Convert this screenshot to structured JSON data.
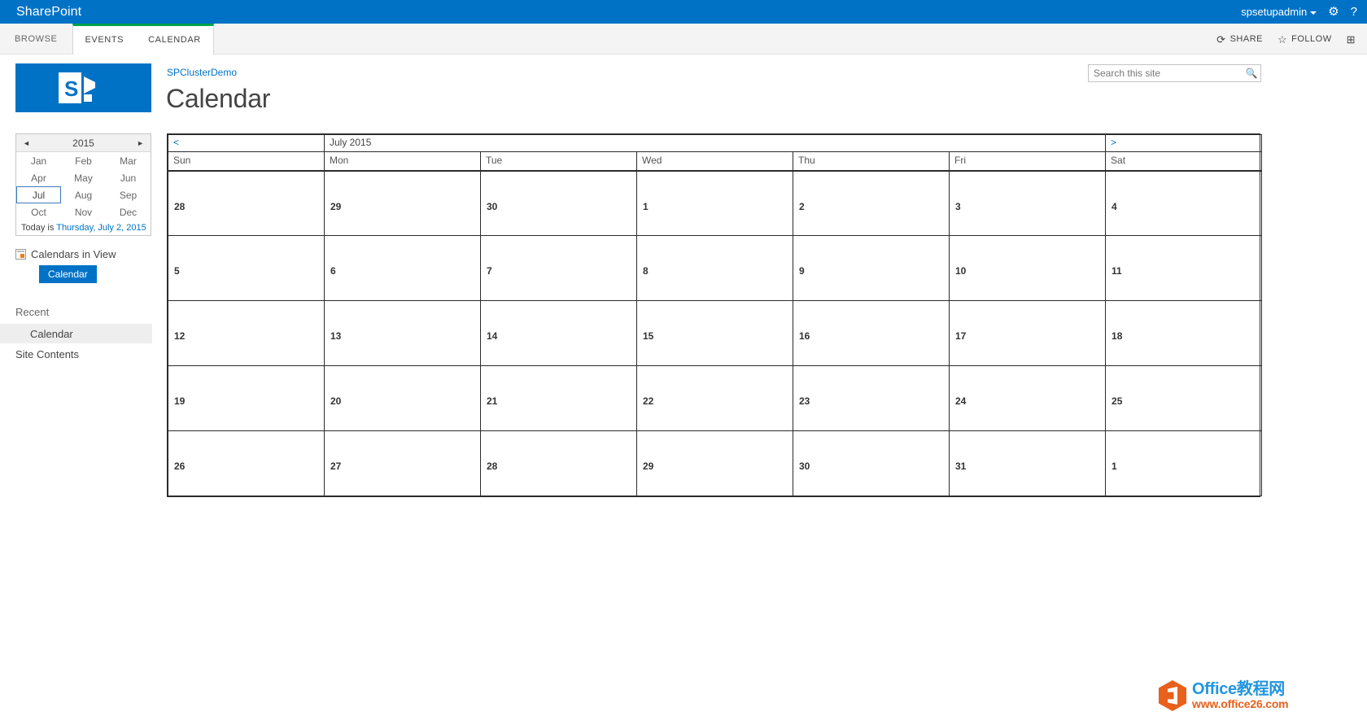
{
  "suitebar": {
    "brand": "SharePoint",
    "user": "spsetupadmin",
    "settings_icon": "gear-icon",
    "help_icon": "help-icon"
  },
  "ribbon": {
    "browse_tab": "BROWSE",
    "tabs": [
      "EVENTS",
      "CALENDAR"
    ],
    "share_label": "SHARE",
    "follow_label": "FOLLOW",
    "focus_label": "focus-on-content-icon"
  },
  "header": {
    "breadcrumb": "SPClusterDemo",
    "title": "Calendar",
    "logo": "sharepoint-logo"
  },
  "search": {
    "placeholder": "Search this site",
    "value": "",
    "icon": "search-icon"
  },
  "monthpicker": {
    "prev_arrow": "◄",
    "next_arrow": "►",
    "year": "2015",
    "months": [
      "Jan",
      "Feb",
      "Mar",
      "Apr",
      "May",
      "Jun",
      "Jul",
      "Aug",
      "Sep",
      "Oct",
      "Nov",
      "Dec"
    ],
    "selected_month": "Jul",
    "today_prefix": "Today is ",
    "today_date": "Thursday, July 2, 2015"
  },
  "calendars_in_view": {
    "label": "Calendars in View",
    "chip": "Calendar"
  },
  "nav": {
    "recent_label": "Recent",
    "recent_item": "Calendar",
    "site_contents": "Site Contents"
  },
  "calendar": {
    "prev_label": "<",
    "next_label": ">",
    "month_title": "July 2015",
    "day_headers": [
      "Sun",
      "Mon",
      "Tue",
      "Wed",
      "Thu",
      "Fri",
      "Sat"
    ],
    "weeks": [
      [
        "28",
        "29",
        "30",
        "1",
        "2",
        "3",
        "4"
      ],
      [
        "5",
        "6",
        "7",
        "8",
        "9",
        "10",
        "11"
      ],
      [
        "12",
        "13",
        "14",
        "15",
        "16",
        "17",
        "18"
      ],
      [
        "19",
        "20",
        "21",
        "22",
        "23",
        "24",
        "25"
      ],
      [
        "26",
        "27",
        "28",
        "29",
        "30",
        "31",
        "1"
      ]
    ]
  },
  "watermark": {
    "line1": "Office教程网",
    "line2": "www.office26.com"
  },
  "colors": {
    "suitebar": "#0072c6",
    "accent": "#0072c6",
    "ribbon_tab_top": "#00a14b",
    "grid_line": "#2b2b2b"
  }
}
